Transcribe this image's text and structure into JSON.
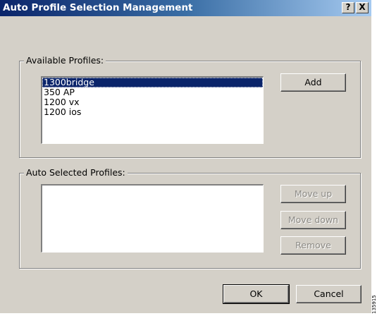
{
  "window": {
    "title": "Auto Profile Selection Management",
    "help_label": "?",
    "close_label": "X"
  },
  "available": {
    "legend": "Available Profiles:",
    "items": [
      "1300bridge",
      "350 AP",
      "1200 vx",
      "1200 ios"
    ],
    "selected_index": 0,
    "add_label": "Add"
  },
  "auto_selected": {
    "legend": "Auto Selected Profiles:",
    "items": [],
    "move_up_label": "Move up",
    "move_down_label": "Move down",
    "remove_label": "Remove"
  },
  "footer": {
    "ok_label": "OK",
    "cancel_label": "Cancel"
  },
  "figure_id": "135915"
}
